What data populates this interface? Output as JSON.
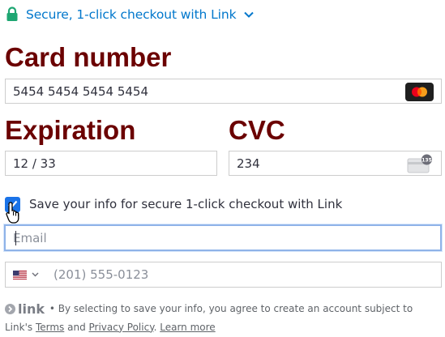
{
  "header": {
    "link_text": "Secure, 1-click checkout with Link"
  },
  "card": {
    "label": "Card number",
    "value": "5454 5454 5454 5454",
    "brand_icon": "mastercard-icon"
  },
  "expiration": {
    "label": "Expiration",
    "value": "12 / 33"
  },
  "cvc": {
    "label": "CVC",
    "value": "234",
    "icon_badge": "135"
  },
  "save_info": {
    "checked": true,
    "label": "Save your info for secure 1-click checkout with Link"
  },
  "email": {
    "placeholder": "Email",
    "value": ""
  },
  "phone": {
    "country_flag": "us-flag-icon",
    "placeholder": "(201) 555-0123",
    "value": ""
  },
  "footer": {
    "logo_text": "link",
    "sentence": " • By selecting to save your info, you agree to create an account subject to Link's ",
    "terms": "Terms",
    "and": " and ",
    "privacy": "Privacy Policy",
    "period": ". ",
    "learn_more": "Learn more"
  },
  "colors": {
    "label": "#6b0000",
    "link_blue": "#0077cc",
    "checkbox": "#1a73e8",
    "lock_green": "#1ea672"
  }
}
